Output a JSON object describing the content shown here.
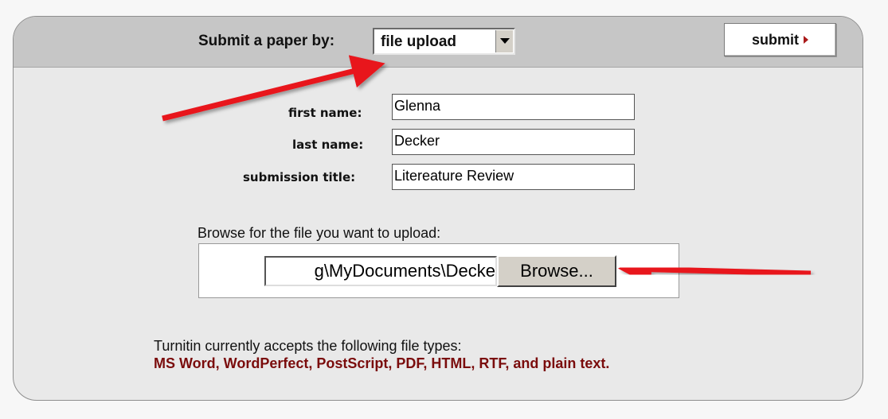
{
  "header": {
    "submit_by_label": "Submit a paper by:",
    "method_value": "file upload",
    "submit_label": "submit"
  },
  "form": {
    "first_name_label": "first name:",
    "first_name_value": "Glenna",
    "last_name_label": "last name:",
    "last_name_value": "Decker",
    "title_label": "submission title:",
    "title_value": "Litereature Review"
  },
  "upload": {
    "browse_prompt": "Browse for the file you want to upload:",
    "file_path": "g\\MyDocuments\\Decke",
    "browse_button_label": "Browse..."
  },
  "file_types": {
    "intro": "Turnitin currently accepts the following file types:",
    "list": "MS Word, WordPerfect, PostScript, PDF, HTML, RTF, and plain text."
  },
  "colors": {
    "annotation_arrow": "#e8141b",
    "file_types_text": "#7a0c0c",
    "header_bg": "#c6c6c6",
    "panel_bg": "#e9e9e9"
  }
}
